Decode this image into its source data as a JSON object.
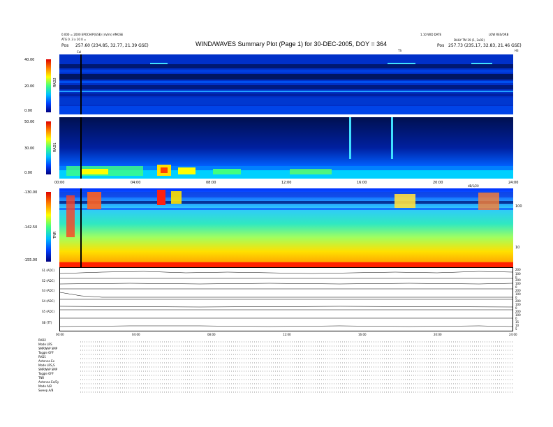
{
  "header": {
    "title": "WIND/WAVES Summary Plot (Page 1) for 30-DEC-2005, DOY = 364",
    "left_line1": "0.000 = 2000 EPOCH/P(GSE) (nV/m) AMGSE",
    "left_line2": "ATG 0 .3 x 10 0 =",
    "left_pos_label": "Pos",
    "left_pos_value": "257.60 (234.85, 32.77, 21.39 GSE)",
    "right_line1": "LOW RES/ORB",
    "center_line1": "1.10 WID DATE",
    "right_line2": "DAILY TM 29 (1, 2x02)",
    "right_pos_label": "Pos",
    "right_pos_value": "257.73 (235.17, 32.83, 21.46 GSE)",
    "cal_label": "Cal",
    "ts_label": "TS",
    "top_right_mark": "H3"
  },
  "panels": {
    "rad2": {
      "label": "RAD2",
      "ticks": [
        "40.00",
        "20.00",
        "0.00"
      ]
    },
    "rad1": {
      "label": "RAD1",
      "ticks": [
        "50.00",
        "30.00",
        "0.00"
      ]
    },
    "tnr": {
      "label": "TNR",
      "ticks": [
        "-130.00",
        "-142.50",
        "-155.00"
      ],
      "right_ticks": [
        "100",
        "10"
      ]
    },
    "tnr_top_label": "dB/1/20"
  },
  "time_axis": {
    "labels": [
      "00:00",
      "04:00",
      "08:00",
      "12:00",
      "16:00",
      "20:00",
      "24:00"
    ],
    "bottom_labels": [
      "00:00",
      "04:00",
      "08:00",
      "12:00",
      "16:00",
      "20:00",
      "24:00"
    ]
  },
  "line_panels": {
    "labels": [
      "S1 (ADC)",
      "S2 (ADC)",
      "S3 (ADC)",
      "S4 (ADC)",
      "S5 (ADC)",
      "SB (TT)"
    ],
    "right_values": [
      [
        "200",
        "100",
        "0"
      ],
      [
        "200",
        "100",
        "0"
      ],
      [
        "200",
        "100",
        "0"
      ],
      [
        "200",
        "100",
        "0"
      ],
      [
        "200",
        "100",
        "0"
      ],
      [
        "15",
        "10",
        "5"
      ]
    ]
  },
  "bottom_text": {
    "lines": [
      "RAD2",
      "Mode  LRS",
      "SMRWAP  SMP",
      "Toggle  OFF",
      "RAD1",
      "Antenna  Ex",
      "Mode  LRS,S",
      "SMRWAP  SMP",
      "Toggle  OFF",
      "TNR",
      "Antenna  Ex/Ey",
      "Mode  A/B",
      "Sweep  A/B"
    ]
  },
  "colors": {
    "spectrogram_low": "#001a8c",
    "spectrogram_bg": "#0030c8",
    "tnr_base": "#20d8d8",
    "tnr_yellow": "#ffe000",
    "tnr_red": "#e81010"
  },
  "chart_data": {
    "type": "heatmap",
    "title": "WIND/WAVES Summary Plot (Page 1) for 30-DEC-2005, DOY = 364",
    "x_range": [
      "00:00",
      "24:00"
    ],
    "panels": [
      "RAD2",
      "RAD1",
      "TNR"
    ],
    "colorbar_ranges": {
      "RAD2": [
        0,
        40
      ],
      "RAD1": [
        0,
        50
      ],
      "TNR": [
        -155,
        -130
      ]
    }
  }
}
